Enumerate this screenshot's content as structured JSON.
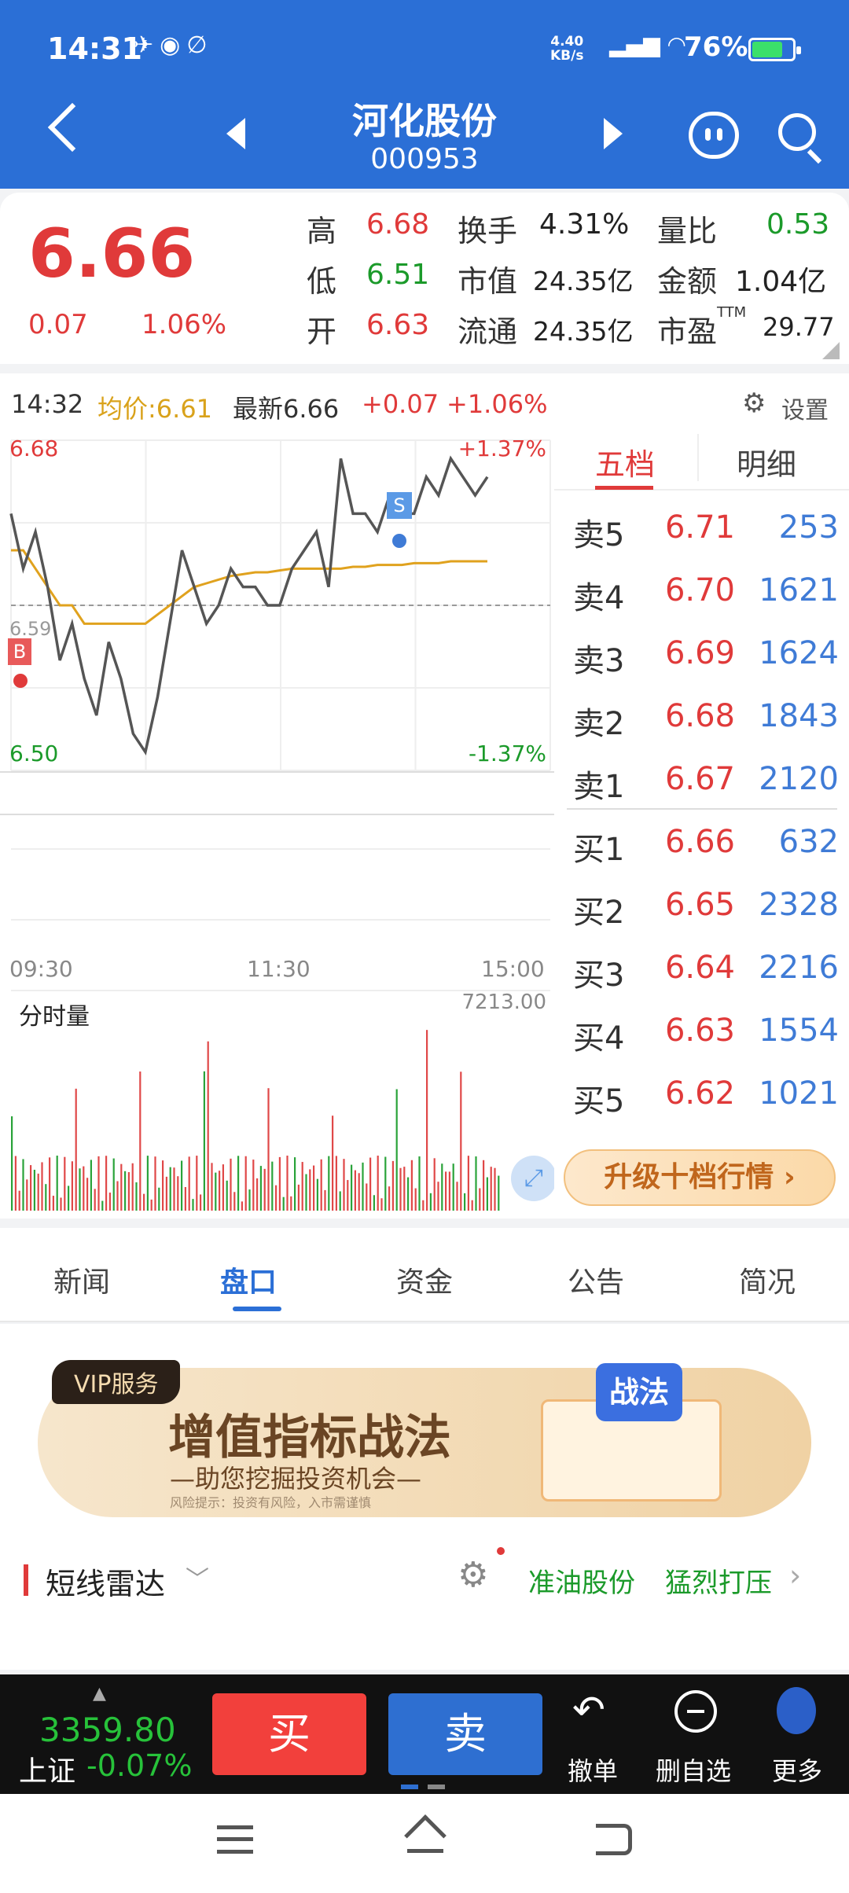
{
  "status": {
    "time": "14:31",
    "net_speed": "4.40",
    "net_unit": "KB/s",
    "signal": "5G HD",
    "battery": "76%",
    "battery_level": 0.76
  },
  "header": {
    "name": "河化股份",
    "code": "000953"
  },
  "quote": {
    "price": "6.66",
    "change": "0.07",
    "change_pct": "1.06%",
    "high_l": "高",
    "high": "6.68",
    "low_l": "低",
    "low": "6.51",
    "open_l": "开",
    "open": "6.63",
    "turnover_l": "换手",
    "turnover": "4.31%",
    "mcap_l": "市值",
    "mcap": "24.35亿",
    "float_l": "流通",
    "float": "24.35亿",
    "vr_l": "量比",
    "vr": "0.53",
    "amount_l": "金额",
    "amount": "1.04亿",
    "pe_l": "市盈",
    "pe_sup": "TTM",
    "pe": "29.77"
  },
  "chart_header": {
    "time": "14:32",
    "avg": "均价:6.61",
    "latest": "最新6.66",
    "chg": "+0.07",
    "pct": "+1.06%",
    "settings": "设置"
  },
  "chart_data": {
    "type": "line",
    "title": "",
    "y_max_label": "6.68",
    "y_min_label": "6.50",
    "mid_label": "6.59",
    "pct_top": "+1.37%",
    "pct_bottom": "-1.37%",
    "x_ticks": [
      "09:30",
      "11:30",
      "15:00"
    ],
    "ylim": [
      6.5,
      6.68
    ],
    "price": [
      6.64,
      6.61,
      6.63,
      6.6,
      6.56,
      6.58,
      6.55,
      6.53,
      6.57,
      6.55,
      6.52,
      6.51,
      6.54,
      6.58,
      6.62,
      6.6,
      6.58,
      6.59,
      6.61,
      6.6,
      6.6,
      6.59,
      6.59,
      6.61,
      6.62,
      6.63,
      6.6,
      6.67,
      6.64,
      6.64,
      6.63,
      6.65,
      6.64,
      6.64,
      6.66,
      6.65,
      6.67,
      6.66,
      6.65,
      6.66
    ],
    "avg": [
      6.62,
      6.62,
      6.61,
      6.6,
      6.59,
      6.59,
      6.58,
      6.58,
      6.58,
      6.58,
      6.58,
      6.58,
      6.585,
      6.59,
      6.595,
      6.6,
      6.602,
      6.604,
      6.606,
      6.607,
      6.608,
      6.608,
      6.609,
      6.61,
      6.61,
      6.61,
      6.61,
      6.61,
      6.611,
      6.611,
      6.612,
      6.612,
      6.612,
      6.613,
      6.613,
      6.613,
      6.614,
      6.614,
      6.614,
      6.614
    ],
    "buy_mark": "B",
    "sell_mark": "S",
    "volume_title": "分时量",
    "volume_max": "7213.00"
  },
  "book": {
    "tab_five": "五档",
    "tab_detail": "明细",
    "asks": [
      {
        "l": "卖5",
        "p": "6.71",
        "v": "253"
      },
      {
        "l": "卖4",
        "p": "6.70",
        "v": "1621"
      },
      {
        "l": "卖3",
        "p": "6.69",
        "v": "1624"
      },
      {
        "l": "卖2",
        "p": "6.68",
        "v": "1843"
      },
      {
        "l": "卖1",
        "p": "6.67",
        "v": "2120"
      }
    ],
    "bids": [
      {
        "l": "买1",
        "p": "6.66",
        "v": "632"
      },
      {
        "l": "买2",
        "p": "6.65",
        "v": "2328"
      },
      {
        "l": "买3",
        "p": "6.64",
        "v": "2216"
      },
      {
        "l": "买4",
        "p": "6.63",
        "v": "1554"
      },
      {
        "l": "买5",
        "p": "6.62",
        "v": "1021"
      }
    ],
    "upgrade": "升级十档行情"
  },
  "tabs": [
    "新闻",
    "盘口",
    "资金",
    "公告",
    "简况"
  ],
  "ad": {
    "badge": "VIP服务",
    "title": "增值指标战法",
    "subtitle": "—助您挖掘投资机会—",
    "risk": "风险提示：投资有风险，入市需谨慎",
    "stamp": "战法"
  },
  "radar": {
    "title": "短线雷达",
    "stock": "准油股份",
    "signal": "猛烈打压"
  },
  "bottom": {
    "index_value": "3359.80",
    "index_name": "上证",
    "index_pct": "-0.07%",
    "buy": "买",
    "sell": "卖",
    "cancel": "撤单",
    "remove": "删自选",
    "more": "更多"
  }
}
